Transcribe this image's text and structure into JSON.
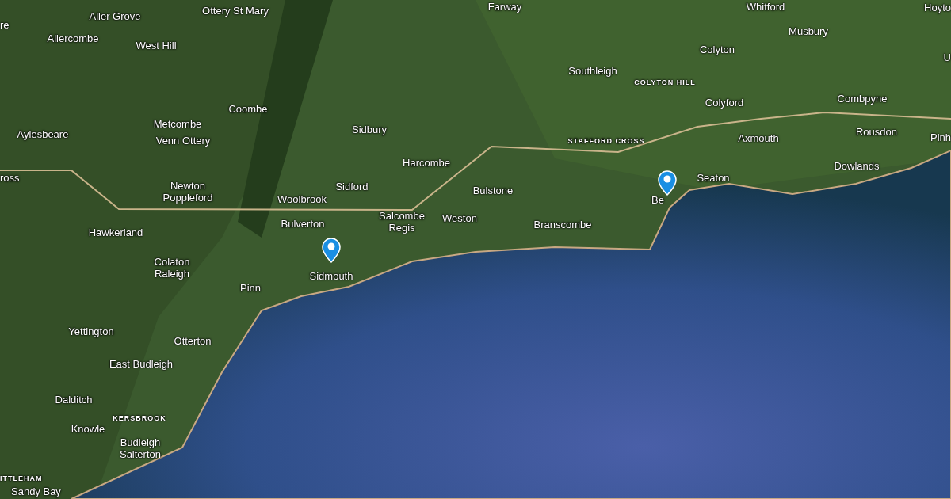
{
  "map": {
    "labels": [
      {
        "text": "Aller Grove",
        "kind": "place"
      },
      {
        "text": "Ottery St Mary",
        "kind": "place"
      },
      {
        "text": "Farway",
        "kind": "place"
      },
      {
        "text": "Whitford",
        "kind": "place"
      },
      {
        "text": "Hoyto",
        "kind": "place"
      },
      {
        "text": "re",
        "kind": "place"
      },
      {
        "text": "Allercombe",
        "kind": "place"
      },
      {
        "text": "West Hill",
        "kind": "place"
      },
      {
        "text": "Musbury",
        "kind": "place"
      },
      {
        "text": "Colyton",
        "kind": "place"
      },
      {
        "text": "Southleigh",
        "kind": "place"
      },
      {
        "text": "COLYTON HILL",
        "kind": "area"
      },
      {
        "text": "U",
        "kind": "place"
      },
      {
        "text": "Coombe",
        "kind": "place"
      },
      {
        "text": "Colyford",
        "kind": "place"
      },
      {
        "text": "Combpyne",
        "kind": "place"
      },
      {
        "text": "Metcombe",
        "kind": "place"
      },
      {
        "text": "Venn Ottery",
        "kind": "place"
      },
      {
        "text": "Aylesbeare",
        "kind": "place"
      },
      {
        "text": "Sidbury",
        "kind": "place"
      },
      {
        "text": "STAFFORD CROSS",
        "kind": "area"
      },
      {
        "text": "Axmouth",
        "kind": "place"
      },
      {
        "text": "Rousdon",
        "kind": "place"
      },
      {
        "text": "Pinh",
        "kind": "place"
      },
      {
        "text": "Harcombe",
        "kind": "place"
      },
      {
        "text": "Dowlands",
        "kind": "place"
      },
      {
        "text": "ross",
        "kind": "place"
      },
      {
        "text": "Newton Poppleford",
        "kind": "place"
      },
      {
        "text": "Woolbrook",
        "kind": "place"
      },
      {
        "text": "Sidford",
        "kind": "place"
      },
      {
        "text": "Bulstone",
        "kind": "place"
      },
      {
        "text": "Seaton",
        "kind": "place"
      },
      {
        "text": "Be",
        "kind": "place"
      },
      {
        "text": "Bulverton",
        "kind": "place"
      },
      {
        "text": "Salcombe Regis",
        "kind": "place"
      },
      {
        "text": "Weston",
        "kind": "place"
      },
      {
        "text": "Branscombe",
        "kind": "place"
      },
      {
        "text": "Hawkerland",
        "kind": "place"
      },
      {
        "text": "Colaton Raleigh",
        "kind": "place"
      },
      {
        "text": "Sidmouth",
        "kind": "place"
      },
      {
        "text": "Pinn",
        "kind": "place"
      },
      {
        "text": "Yettington",
        "kind": "place"
      },
      {
        "text": "Otterton",
        "kind": "place"
      },
      {
        "text": "East Budleigh",
        "kind": "place"
      },
      {
        "text": "Dalditch",
        "kind": "place"
      },
      {
        "text": "KERSBROOK",
        "kind": "area"
      },
      {
        "text": "Knowle",
        "kind": "place"
      },
      {
        "text": "Budleigh Salterton",
        "kind": "place"
      },
      {
        "text": "ITTLEHAM",
        "kind": "area"
      },
      {
        "text": "Sandy Bay",
        "kind": "place"
      }
    ]
  }
}
